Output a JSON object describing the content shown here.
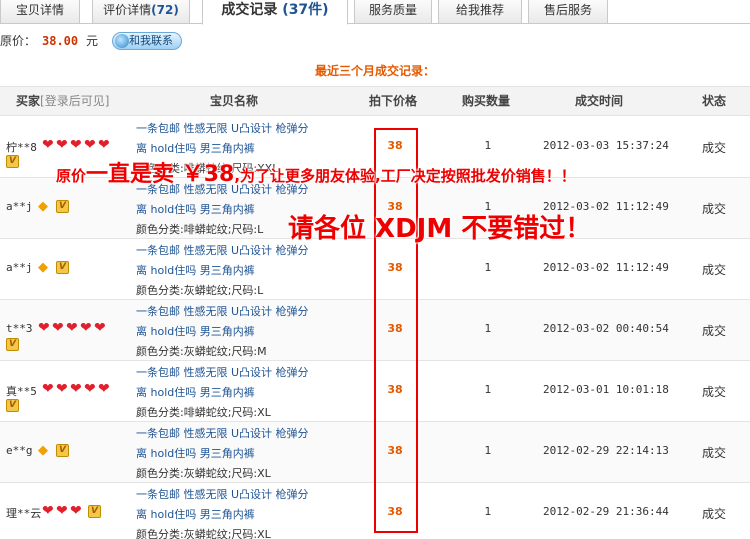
{
  "tabs": [
    {
      "label": "宝贝详情"
    },
    {
      "label": "评价详情",
      "count": "(72)"
    },
    {
      "label": "成交记录",
      "count": "(37件)"
    },
    {
      "label": "服务质量"
    },
    {
      "label": "给我推荐"
    },
    {
      "label": "售后服务"
    }
  ],
  "price": {
    "label": "原价：",
    "value": "38.00",
    "unit": "元",
    "contact_label": "和我联系"
  },
  "section_title": "最近三个月成交记录：",
  "table": {
    "headers": {
      "buyer": "买家",
      "buyer_hint": "[登录后可见]",
      "item": "宝贝名称",
      "price": "拍下价格",
      "qty": "购买数量",
      "time": "成交时间",
      "status": "状态"
    },
    "rows": [
      {
        "buyer": "柠**8",
        "hearts": 5,
        "diamonds": 0,
        "line1": "一条包邮 性感无限 U凸设计 枪弹分",
        "line2": "离 hold住吗 男三角内裤",
        "line3": "颜色分类:啡蟒蛇纹;尺码:XXL",
        "price": "38",
        "qty": "1",
        "time": "2012-03-03 15:37:24",
        "status": "成交"
      },
      {
        "buyer": "a**j",
        "hearts": 0,
        "diamonds": 1,
        "line1": "一条包邮 性感无限 U凸设计 枪弹分",
        "line2": "离 hold住吗 男三角内裤",
        "line3": "颜色分类:啡蟒蛇纹;尺码:L",
        "price": "38",
        "qty": "1",
        "time": "2012-03-02 11:12:49",
        "status": "成交"
      },
      {
        "buyer": "a**j",
        "hearts": 0,
        "diamonds": 1,
        "line1": "一条包邮 性感无限 U凸设计 枪弹分",
        "line2": "离 hold住吗 男三角内裤",
        "line3": "颜色分类:灰蟒蛇纹;尺码:L",
        "price": "38",
        "qty": "1",
        "time": "2012-03-02 11:12:49",
        "status": "成交"
      },
      {
        "buyer": "t**3",
        "hearts": 5,
        "diamonds": 0,
        "line1": "一条包邮 性感无限 U凸设计 枪弹分",
        "line2": "离 hold住吗 男三角内裤",
        "line3": "颜色分类:灰蟒蛇纹;尺码:M",
        "price": "38",
        "qty": "1",
        "time": "2012-03-02 00:40:54",
        "status": "成交"
      },
      {
        "buyer": "真**5",
        "hearts": 5,
        "diamonds": 0,
        "line1": "一条包邮 性感无限 U凸设计 枪弹分",
        "line2": "离 hold住吗 男三角内裤",
        "line3": "颜色分类:啡蟒蛇纹;尺码:XL",
        "price": "38",
        "qty": "1",
        "time": "2012-03-01 10:01:18",
        "status": "成交"
      },
      {
        "buyer": "e**g",
        "hearts": 0,
        "diamonds": 1,
        "line1": "一条包邮 性感无限 U凸设计 枪弹分",
        "line2": "离 hold住吗 男三角内裤",
        "line3": "颜色分类:灰蟒蛇纹;尺码:XL",
        "price": "38",
        "qty": "1",
        "time": "2012-02-29 22:14:13",
        "status": "成交"
      },
      {
        "buyer": "理**云",
        "hearts": 3,
        "diamonds": 0,
        "line1": "一条包邮 性感无限 U凸设计 枪弹分",
        "line2": "离 hold住吗 男三角内裤",
        "line3": "颜色分类:灰蟒蛇纹;尺码:XL",
        "price": "38",
        "qty": "1",
        "time": "2012-02-29 21:36:44",
        "status": "成交"
      }
    ]
  },
  "overlay": {
    "line1_a": "原价",
    "line1_b": "一直是卖",
    "line1_c": " ￥38",
    "line1_d": ",为了让更多朋友体验,工厂决定按照批发价销售！！",
    "line2": "请各位 XDJM 不要错过！",
    "color": "#e00000"
  },
  "icons": {
    "vip": "vip-badge-icon",
    "heart": "heart-rank-icon",
    "diamond": "diamond-rank-icon",
    "contact": "wangwang-icon"
  }
}
